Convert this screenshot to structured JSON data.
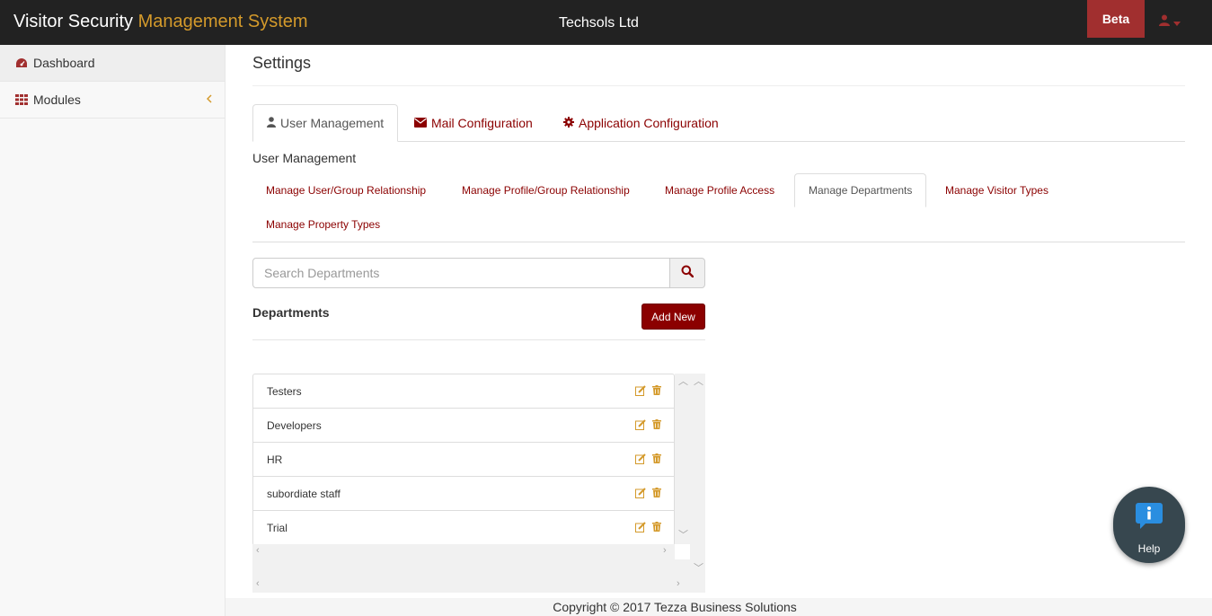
{
  "header": {
    "brand_main": "Visitor Security",
    "brand_accent": "Management System",
    "company": "Techsols Ltd",
    "beta_label": "Beta",
    "user_icon": "user-icon"
  },
  "sidebar": {
    "items": [
      {
        "label": "Dashboard",
        "icon": "dashboard-icon"
      },
      {
        "label": "Modules",
        "icon": "grid-icon"
      }
    ]
  },
  "main": {
    "title": "Settings",
    "tabs": [
      {
        "label": "User Management",
        "icon": "user-icon"
      },
      {
        "label": "Mail Configuration",
        "icon": "envelope-icon"
      },
      {
        "label": "Application Configuration",
        "icon": "gear-icon"
      }
    ],
    "section_label": "User Management",
    "subtabs": [
      {
        "label": "Manage User/Group Relationship"
      },
      {
        "label": "Manage Profile/Group Relationship"
      },
      {
        "label": "Manage Profile Access"
      },
      {
        "label": "Manage Departments"
      },
      {
        "label": "Manage Visitor Types"
      },
      {
        "label": "Manage Property Types"
      }
    ],
    "search": {
      "placeholder": "Search Departments"
    },
    "departments_heading": "Departments",
    "add_new_label": "Add New",
    "departments": [
      "Testers",
      "Developers",
      "HR",
      "subordiate staff",
      "Trial"
    ]
  },
  "footer": {
    "text": "Copyright © 2017 Tezza Business Solutions"
  },
  "help": {
    "label": "Help"
  },
  "colors": {
    "accent": "#d49a2b",
    "brand_red": "#8b0000",
    "beta_bg": "#a12f2f",
    "topbar": "#222222"
  }
}
